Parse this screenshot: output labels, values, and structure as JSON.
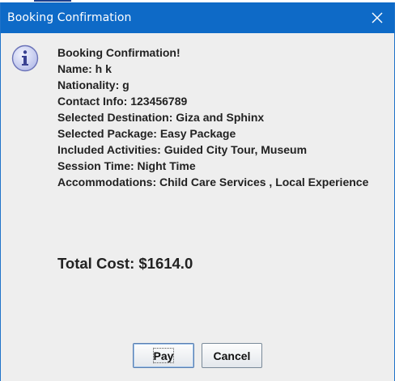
{
  "window": {
    "title": "Booking Confirmation",
    "close_icon": "close-icon"
  },
  "dialog": {
    "icon": "info-icon",
    "message_lines": [
      "Booking Confirmation!",
      "Name: h k",
      "Nationality: g",
      "Contact Info: 123456789",
      "Selected Destination: Giza and Sphinx",
      "Selected Package: Easy Package",
      "Included Activities: Guided City Tour, Museum",
      "Session Time: Night Time",
      "Accommodations: Child Care Services , Local Experience"
    ],
    "total_cost": "Total Cost: $1614.0"
  },
  "buttons": {
    "pay_label": "Pay",
    "cancel_label": "Cancel"
  },
  "colors": {
    "title_bar": "#0e6ac7",
    "background": "#eeeeee",
    "text": "#222222",
    "info_icon_fill": "#c9cff0",
    "info_icon_stroke": "#6b73b8"
  }
}
